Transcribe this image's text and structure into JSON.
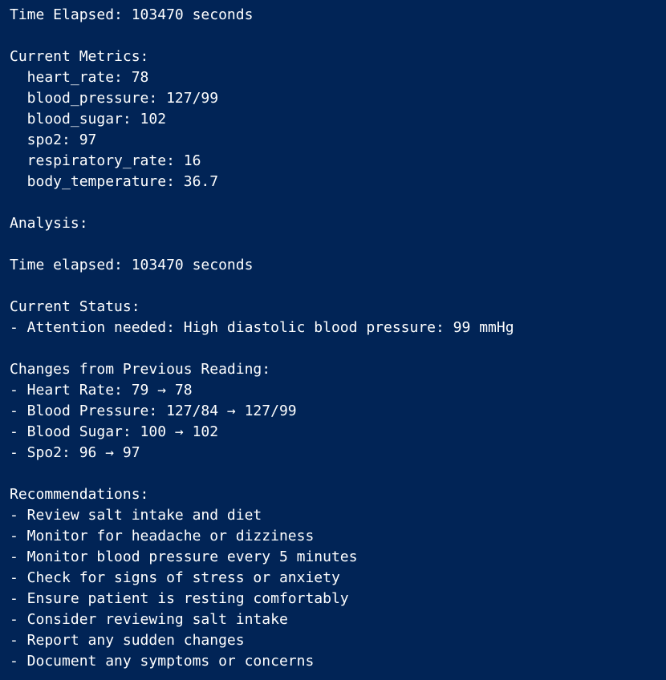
{
  "terminal": {
    "background": "#012456",
    "foreground": "#ffffff",
    "lines": [
      "Time Elapsed: 103470 seconds",
      "",
      "Current Metrics:",
      "  heart_rate: 78",
      "  blood_pressure: 127/99",
      "  blood_sugar: 102",
      "  spo2: 97",
      "  respiratory_rate: 16",
      "  body_temperature: 36.7",
      "",
      "Analysis:",
      "",
      "Time elapsed: 103470 seconds",
      "",
      "Current Status:",
      "- Attention needed: High diastolic blood pressure: 99 mmHg",
      "",
      "Changes from Previous Reading:",
      "- Heart Rate: 79 → 78",
      "- Blood Pressure: 127/84 → 127/99",
      "- Blood Sugar: 100 → 102",
      "- Spo2: 96 → 97",
      "",
      "Recommendations:",
      "- Review salt intake and diet",
      "- Monitor for headache or dizziness",
      "- Monitor blood pressure every 5 minutes",
      "- Check for signs of stress or anxiety",
      "- Ensure patient is resting comfortably",
      "- Consider reviewing salt intake",
      "- Report any sudden changes",
      "- Document any symptoms or concerns"
    ]
  }
}
